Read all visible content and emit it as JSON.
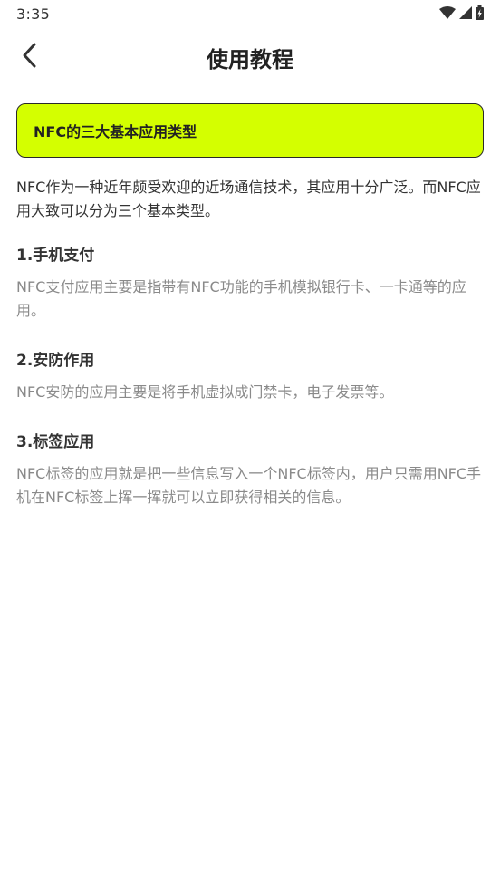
{
  "status_bar": {
    "time": "3:35"
  },
  "header": {
    "title": "使用教程",
    "back_icon": "chevron-left-icon"
  },
  "banner": {
    "label": "NFC的三大基本应用类型"
  },
  "intro": "NFC作为一种近年颇受欢迎的近场通信技术，其应用十分广泛。而NFC应用大致可以分为三个基本类型。",
  "items": [
    {
      "heading": "1.手机支付",
      "body": "NFC支付应用主要是指带有NFC功能的手机模拟银行卡、一卡通等的应用。"
    },
    {
      "heading": "2.安防作用",
      "body": "NFC安防的应用主要是将手机虚拟成门禁卡，电子发票等。"
    },
    {
      "heading": "3.标签应用",
      "body": "NFC标签的应用就是把一些信息写入一个NFC标签内，用户只需用NFC手机在NFC标签上挥一挥就可以立即获得相关的信息。"
    }
  ],
  "colors": {
    "banner_bg": "#d4ff00",
    "body_text": "#8a8a8a"
  }
}
